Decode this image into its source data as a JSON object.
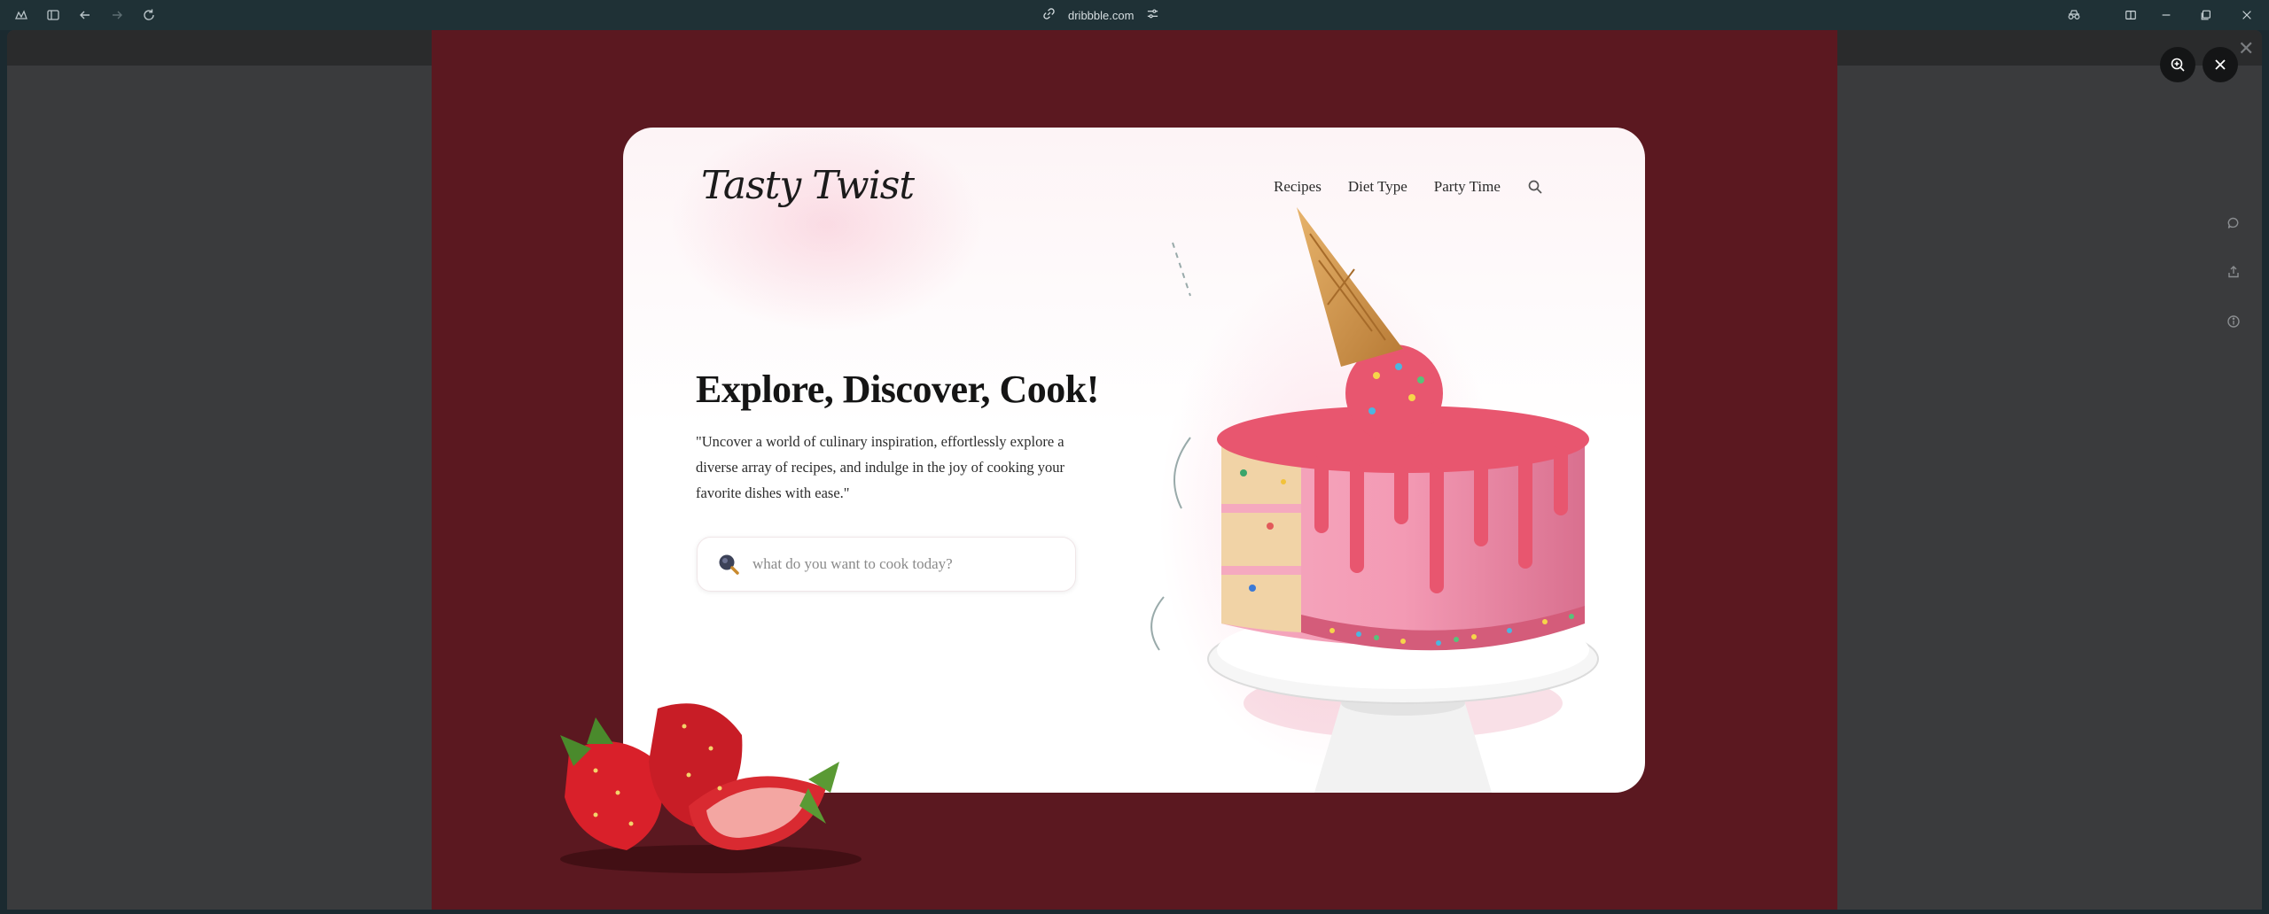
{
  "browser": {
    "url": "dribbble.com",
    "icons": [
      "workspaces-icon",
      "sidebar-icon",
      "back-icon",
      "forward-icon",
      "reload-icon",
      "link-icon",
      "site-settings-icon",
      "incognito-icon",
      "split-view-icon",
      "minimize-icon",
      "maximize-icon",
      "close-icon"
    ]
  },
  "viewer": {
    "icons": [
      "zoom-in-icon",
      "close-icon",
      "comment-icon",
      "share-icon",
      "info-icon"
    ],
    "frame_color": "#5b1820"
  },
  "site": {
    "brand": "Tasty Twist",
    "nav": [
      "Recipes",
      "Diet Type",
      "Party Time"
    ],
    "hero_title": "Explore, Discover, Cook!",
    "hero_subtitle": "\"Uncover a world of culinary inspiration, effortlessly explore a diverse array of recipes, and indulge in the joy of cooking your favorite dishes with ease.\"",
    "search_placeholder": "what do you want to cook today?",
    "accent": "#e8566f"
  }
}
